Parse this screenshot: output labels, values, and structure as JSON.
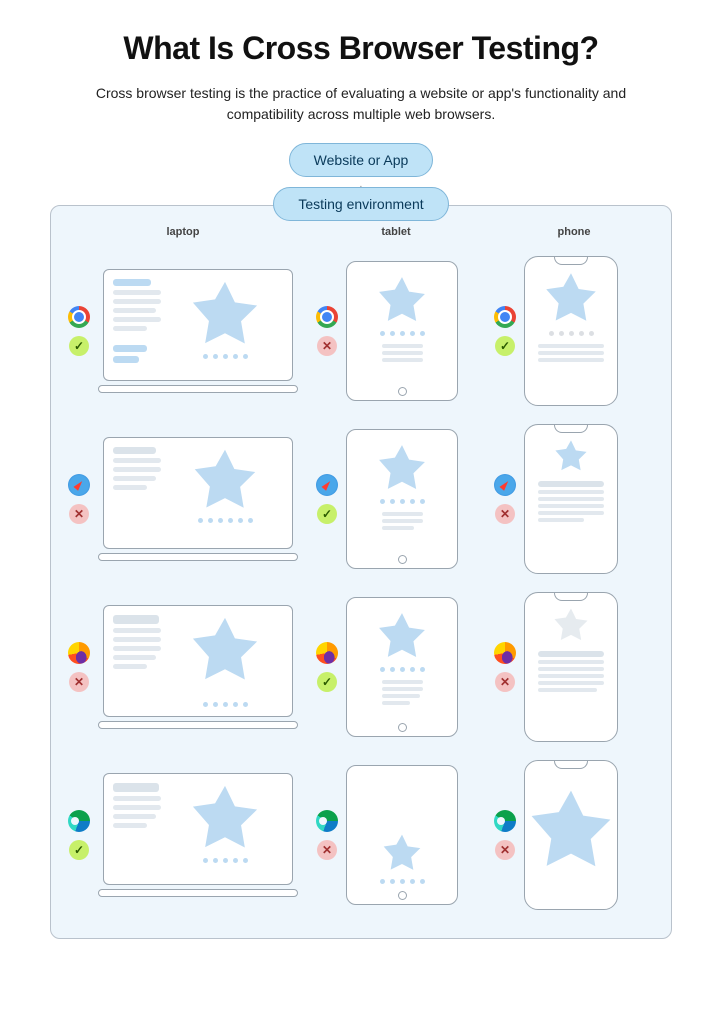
{
  "title": "What Is Cross Browser Testing?",
  "subtitle": "Cross browser testing is the practice of evaluating a website or app's functionality and compatibility across multiple web browsers.",
  "pill_source": "Website or App",
  "pill_env": "Testing environment",
  "columns": {
    "laptop": "laptop",
    "tablet": "tablet",
    "phone": "phone"
  },
  "browsers": [
    {
      "id": "chrome",
      "name": "Chrome"
    },
    {
      "id": "safari",
      "name": "Safari"
    },
    {
      "id": "firefox",
      "name": "Firefox"
    },
    {
      "id": "edge",
      "name": "Edge"
    }
  ],
  "results": {
    "chrome": {
      "laptop": "pass",
      "tablet": "fail",
      "phone": "pass"
    },
    "safari": {
      "laptop": "fail",
      "tablet": "pass",
      "phone": "fail"
    },
    "firefox": {
      "laptop": "fail",
      "tablet": "pass",
      "phone": "fail"
    },
    "edge": {
      "laptop": "pass",
      "tablet": "fail",
      "phone": "fail"
    }
  },
  "glyph": {
    "pass": "✓",
    "fail": "✕"
  }
}
